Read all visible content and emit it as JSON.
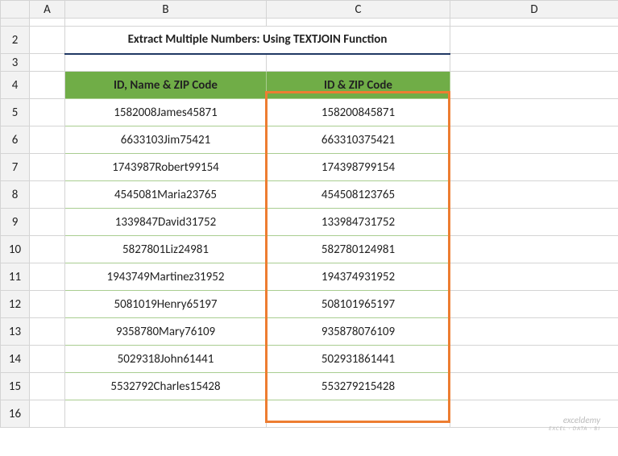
{
  "columns": [
    "A",
    "B",
    "C",
    "D"
  ],
  "rows": [
    "2",
    "3",
    "4",
    "5",
    "6",
    "7",
    "8",
    "9",
    "10",
    "11",
    "12",
    "13",
    "14",
    "15",
    "16"
  ],
  "title": "Extract Multiple Numbers: Using TEXTJOIN Function",
  "headers": {
    "b": "ID, Name & ZIP Code",
    "c": "ID & ZIP Code"
  },
  "table": [
    {
      "b": "1582008James45871",
      "c": "158200845871"
    },
    {
      "b": "6633103Jim75421",
      "c": "663310375421"
    },
    {
      "b": "1743987Robert99154",
      "c": "174398799154"
    },
    {
      "b": "4545081Maria23765",
      "c": "454508123765"
    },
    {
      "b": "1339847David31752",
      "c": "133984731752"
    },
    {
      "b": "5827801Liz24981",
      "c": "582780124981"
    },
    {
      "b": "1943749Martinez31952",
      "c": "194374931952"
    },
    {
      "b": "5081019Henry65197",
      "c": "508101965197"
    },
    {
      "b": "9358780Mary76109",
      "c": "935878076109"
    },
    {
      "b": "5029318John61441",
      "c": "502931861441"
    },
    {
      "b": "5532792Charles15428",
      "c": "553279215428"
    }
  ],
  "watermark": {
    "main": "exceldemy",
    "sub": "EXCEL · DATA · BI"
  }
}
